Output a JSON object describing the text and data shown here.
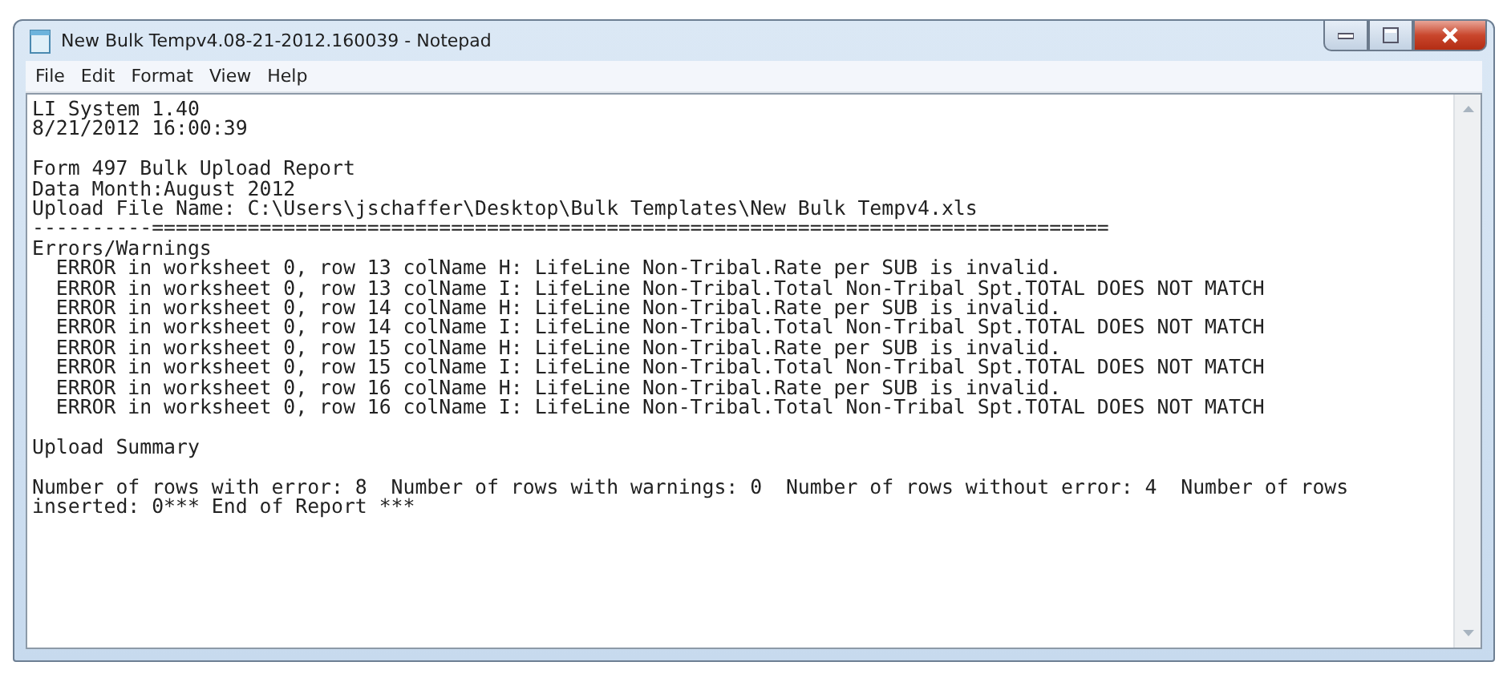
{
  "window": {
    "title": "New Bulk Tempv4.08-21-2012.160039 - Notepad"
  },
  "menu": [
    "File",
    "Edit",
    "Format",
    "View",
    "Help"
  ],
  "document": {
    "blocks": [
      [
        "LI System 1.40",
        "8/21/2012 16:00:39"
      ],
      [
        "Form 497 Bulk Upload Report",
        "Data Month:August 2012",
        "Upload File Name: C:\\Users\\jschaffer\\Desktop\\Bulk Templates\\New Bulk Tempv4.xls",
        "----------================================================================================",
        "Errors/Warnings",
        "  ERROR in worksheet 0, row 13 colName H: LifeLine Non-Tribal.Rate per SUB is invalid.",
        "  ERROR in worksheet 0, row 13 colName I: LifeLine Non-Tribal.Total Non-Tribal Spt.TOTAL DOES NOT MATCH",
        "  ERROR in worksheet 0, row 14 colName H: LifeLine Non-Tribal.Rate per SUB is invalid.",
        "  ERROR in worksheet 0, row 14 colName I: LifeLine Non-Tribal.Total Non-Tribal Spt.TOTAL DOES NOT MATCH",
        "  ERROR in worksheet 0, row 15 colName H: LifeLine Non-Tribal.Rate per SUB is invalid.",
        "  ERROR in worksheet 0, row 15 colName I: LifeLine Non-Tribal.Total Non-Tribal Spt.TOTAL DOES NOT MATCH",
        "  ERROR in worksheet 0, row 16 colName H: LifeLine Non-Tribal.Rate per SUB is invalid.",
        "  ERROR in worksheet 0, row 16 colName I: LifeLine Non-Tribal.Total Non-Tribal Spt.TOTAL DOES NOT MATCH"
      ],
      [
        "Upload Summary"
      ],
      [
        "Number of rows with error: 8  Number of rows with warnings: 0  Number of rows without error: 4  Number of rows inserted: 0*** End of Report ***"
      ]
    ]
  }
}
